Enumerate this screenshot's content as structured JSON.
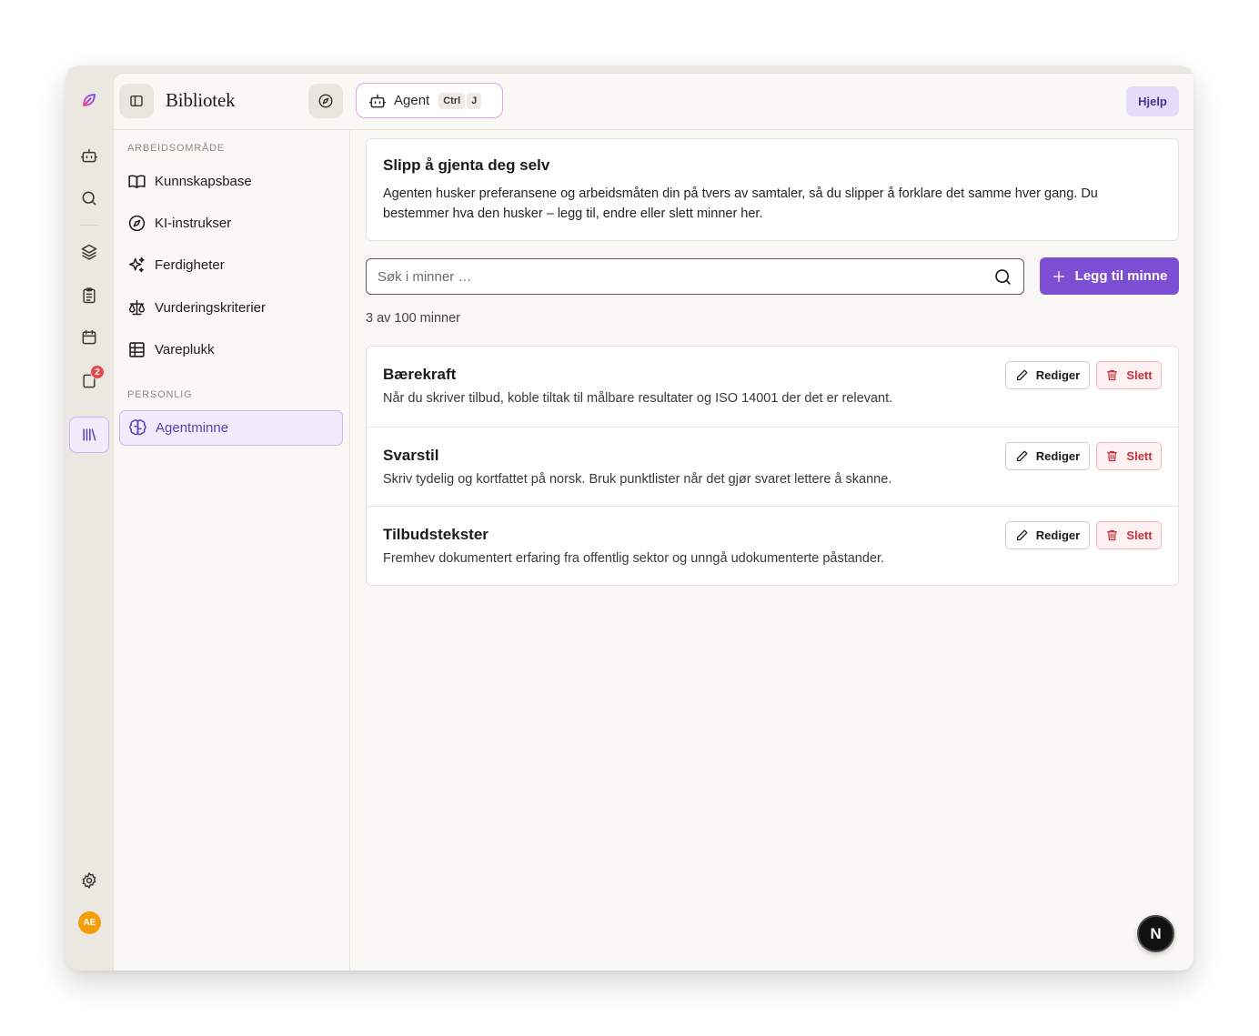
{
  "topbar": {
    "title": "Bibliotek",
    "agent_label": "Agent",
    "shortcut_ctrl": "Ctrl",
    "shortcut_key": "J",
    "help_label": "Hjelp"
  },
  "rail": {
    "badge_count": "2",
    "avatar_initials": "AE",
    "accent_color": "#7c4ed3"
  },
  "sidebar": {
    "workspace_label": "ARBEIDSOMRÅDE",
    "workspace_items": [
      {
        "label": "Kunnskapsbase",
        "icon": "book-open-icon"
      },
      {
        "label": "KI-instrukser",
        "icon": "compass-icon"
      },
      {
        "label": "Ferdigheter",
        "icon": "sparkles-icon"
      },
      {
        "label": "Vurderingskriterier",
        "icon": "scale-icon"
      },
      {
        "label": "Vareplukk",
        "icon": "table-icon"
      }
    ],
    "personal_label": "PERSONLIG",
    "personal_items": [
      {
        "label": "Agentminne",
        "icon": "brain-icon",
        "active": true
      }
    ]
  },
  "intro": {
    "title": "Slipp å gjenta deg selv",
    "text": "Agenten husker preferansene og arbeidsmåten din på tvers av samtaler, så du slipper å forklare det samme hver gang. Du bestemmer hva den husker – legg til, endre eller slett minner her."
  },
  "search": {
    "placeholder": "Søk i minner …",
    "value": ""
  },
  "add_button": "Legg til minne",
  "count_text": "3 av 100 minner",
  "memories": [
    {
      "title": "Bærekraft",
      "text": "Når du skriver tilbud, koble tiltak til målbare resultater og ISO 14001 der det er relevant.",
      "edit_label": "Rediger",
      "delete_label": "Slett"
    },
    {
      "title": "Svarstil",
      "text": "Skriv tydelig og kortfattet på norsk. Bruk punktlister når det gjør svaret lettere å skanne.",
      "edit_label": "Rediger",
      "delete_label": "Slett"
    },
    {
      "title": "Tilbudstekster",
      "text": "Fremhev dokumentert erfaring fra offentlig sektor og unngå udokumenterte påstander.",
      "edit_label": "Rediger",
      "delete_label": "Slett"
    }
  ],
  "fab_label": "N"
}
